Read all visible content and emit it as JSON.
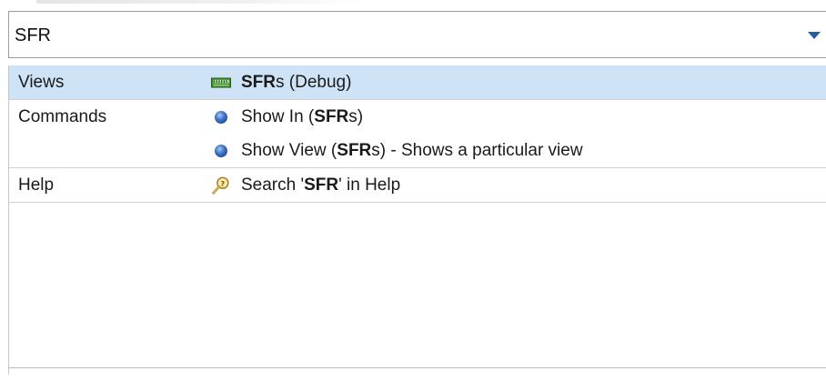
{
  "search": {
    "value": "SFR",
    "dropdown_icon": "chevron-down-icon"
  },
  "colors": {
    "selection": "#cfe3f6",
    "accent": "#2c5aa0"
  },
  "groups": [
    {
      "category": "Views",
      "items": [
        {
          "icon": "register-icon",
          "bold": "SFR",
          "pre": "",
          "post": "s (Debug)",
          "selected": true
        }
      ]
    },
    {
      "category": "Commands",
      "items": [
        {
          "icon": "blue-dot-icon",
          "pre": "Show In (",
          "bold": "SFR",
          "post": "s)",
          "selected": false
        },
        {
          "icon": "blue-dot-icon",
          "pre": "Show View (",
          "bold": "SFR",
          "post": "s) - Shows a particular view",
          "selected": false
        }
      ]
    },
    {
      "category": "Help",
      "items": [
        {
          "icon": "help-search-icon",
          "pre": "Search '",
          "bold": "SFR",
          "post": "' in Help",
          "selected": false
        }
      ]
    }
  ]
}
